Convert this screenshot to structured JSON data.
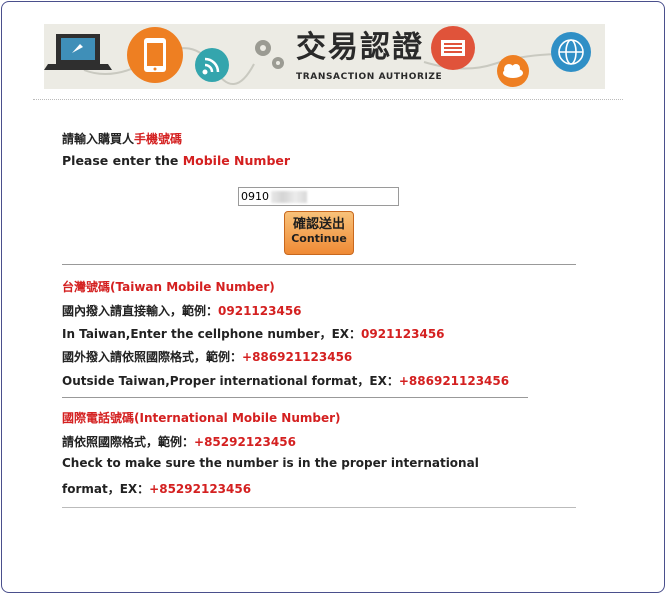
{
  "banner": {
    "title": "交易認證",
    "subtitle": "TRANSACTION AUTHORIZE"
  },
  "prompt": {
    "zh_prefix": "請輸入購買人",
    "zh_highlight": "手機號碼",
    "en_prefix": "Please enter the ",
    "en_highlight": "Mobile Number"
  },
  "form": {
    "phone_value": "0910"
  },
  "submit_button": {
    "line1": "確認送出",
    "line2": "Continue"
  },
  "taiwan_section": {
    "heading": "台灣號碼(Taiwan Mobile Number)",
    "zh_domestic": "國內撥入請直接輸入，範例：",
    "domestic_example": "0921123456",
    "en_domestic": "In Taiwan,Enter the cellphone number，EX：",
    "zh_abroad": "國外撥入請依照國際格式，範例：",
    "abroad_example": "+886921123456",
    "en_abroad": "Outside Taiwan,Proper international format，EX："
  },
  "intl_section": {
    "heading": "國際電話號碼(International Mobile Number)",
    "zh_hint": "請依照國際格式，範例：",
    "example": "+85292123456",
    "en_line1": "Check to make sure the number is in the proper international",
    "en_line2": "format，EX："
  },
  "colors": {
    "highlight": "#d42020",
    "button": "#ef8a35",
    "frame": "#4a4f8c"
  }
}
